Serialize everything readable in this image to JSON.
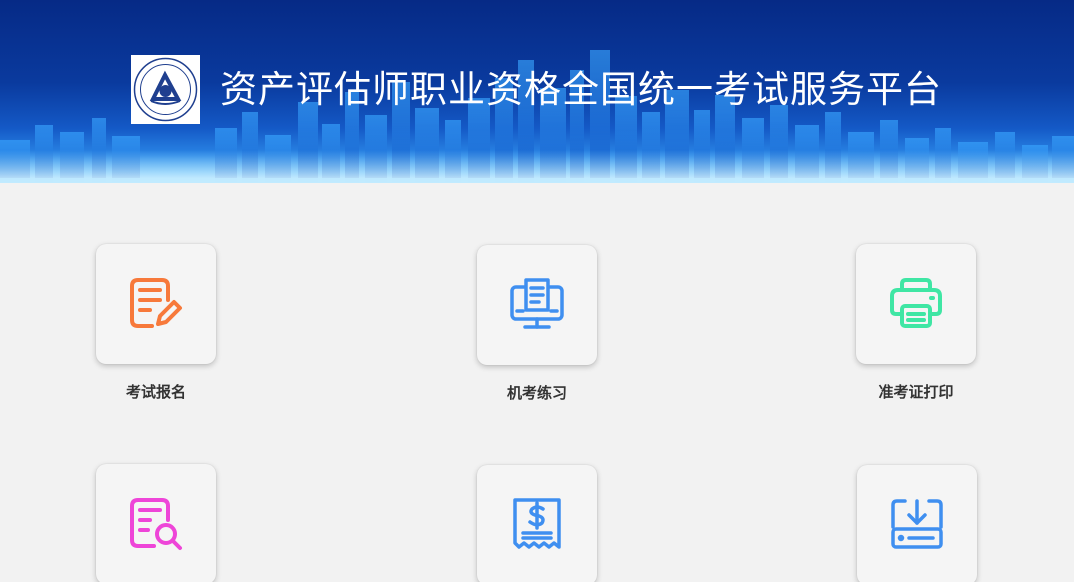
{
  "header": {
    "title": "资产评估师职业资格全国统一考试服务平台",
    "logo_icon": "china-appraisal-society-logo",
    "logo_text": "中国资产评估协会 China Appraisal Society"
  },
  "colors": {
    "header_dark": "#062a86",
    "header_light": "#6fc6ff",
    "orange": "#f7793b",
    "blue": "#3f8ff0",
    "green": "#3fe6a4",
    "magenta": "#ee45d8"
  },
  "tiles": [
    {
      "label": "考试报名",
      "icon": "registration-form-icon"
    },
    {
      "label": "机考练习",
      "icon": "computer-test-icon"
    },
    {
      "label": "准考证打印",
      "icon": "printer-icon"
    },
    {
      "label": "",
      "icon": "document-search-icon"
    },
    {
      "label": "",
      "icon": "receipt-dollar-icon"
    },
    {
      "label": "",
      "icon": "download-box-icon"
    }
  ]
}
